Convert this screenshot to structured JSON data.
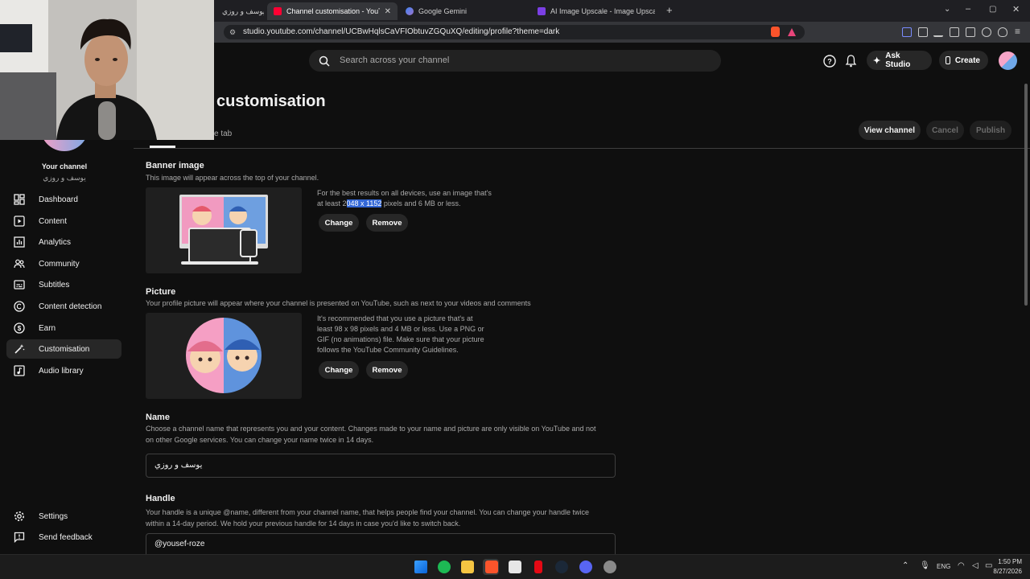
{
  "browser": {
    "tabs": [
      {
        "label": "يوسف و روزي - YouTube"
      },
      {
        "label": "Channel customisation - YouTube"
      },
      {
        "label": "Google Gemini"
      },
      {
        "label": "AI Image Upscale - Image Upscaler o"
      }
    ],
    "url": "studio.youtube.com/channel/UCBwHqlsCaVFIObtuvZGQuXQ/editing/profile?theme=dark"
  },
  "header": {
    "search_placeholder": "Search across your channel",
    "ask_studio": "Ask Studio",
    "create": "Create"
  },
  "sidebar": {
    "channel_label": "Your channel",
    "channel_name": "يوسف و روزي",
    "items": [
      {
        "label": "Dashboard",
        "icon": "dashboard-icon"
      },
      {
        "label": "Content",
        "icon": "content-icon"
      },
      {
        "label": "Analytics",
        "icon": "analytics-icon"
      },
      {
        "label": "Community",
        "icon": "community-icon"
      },
      {
        "label": "Subtitles",
        "icon": "subtitles-icon"
      },
      {
        "label": "Content detection",
        "icon": "copyright-icon"
      },
      {
        "label": "Earn",
        "icon": "earn-icon"
      },
      {
        "label": "Customisation",
        "icon": "customisation-icon"
      },
      {
        "label": "Audio library",
        "icon": "audio-library-icon"
      }
    ],
    "settings": "Settings",
    "feedback": "Send feedback"
  },
  "page": {
    "title": "customisation",
    "tab_partial": "e tab",
    "view_channel": "View channel",
    "cancel": "Cancel",
    "publish": "Publish"
  },
  "banner": {
    "title": "Banner image",
    "desc": "This image will appear across the top of your channel.",
    "hint_line1": "For the best results on all devices, use an image that's",
    "hint_pre": "at least 2",
    "hint_sel": "048 x 1152",
    "hint_post": " pixels and 6 MB or less.",
    "change": "Change",
    "remove": "Remove"
  },
  "picture": {
    "title": "Picture",
    "desc": "Your profile picture will appear where your channel is presented on YouTube, such as next to your videos and comments",
    "hint_line1": "It's recommended that you use a picture that's at",
    "hint_line2": "least 98 x 98 pixels and 4 MB or less. Use a PNG or",
    "hint_line3": "GIF (no animations) file. Make sure that your picture",
    "hint_line4": "follows the YouTube Community Guidelines.",
    "change": "Change",
    "remove": "Remove"
  },
  "name": {
    "title": "Name",
    "desc_line1": "Choose a channel name that represents you and your content. Changes made to your name and picture are only visible on YouTube and not",
    "desc_line2": "on other Google services. You can change your name twice in 14 days.",
    "value": "يوسف و روزي"
  },
  "handle": {
    "title": "Handle",
    "desc_line1": "Your handle is a unique @name, different from your channel name, that helps people find your channel. You can change your handle twice",
    "desc_line2": "within a 14-day period. We hold your previous handle for 14 days in case you'd like to switch back.",
    "value": "@yousef-roze"
  },
  "taskbar": {
    "lang": "ENG",
    "time": "1:50 PM",
    "date": "8/27/2026"
  },
  "colors": {
    "accent_red": "#ff0033",
    "bg": "#0f0f0f",
    "selection": "#3367d6"
  }
}
